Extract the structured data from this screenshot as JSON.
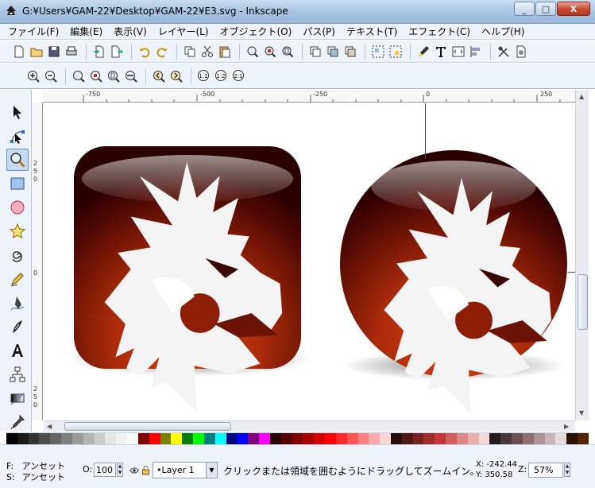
{
  "window": {
    "title": "G:¥Users¥GAM-22¥Desktop¥GAM-22¥E3.svg - Inkscape",
    "minimize": "_",
    "maximize": "□",
    "close": "X"
  },
  "menu": [
    "ファイル(F)",
    "編集(E)",
    "表示(V)",
    "レイヤー(L)",
    "オブジェクト(O)",
    "パス(P)",
    "テキスト(T)",
    "エフェクト(C)",
    "ヘルプ(H)"
  ],
  "ruler": {
    "h": [
      "-750",
      "-500",
      "-250",
      "0",
      "250"
    ],
    "v": [
      "2",
      "5",
      "0",
      "2",
      "5",
      "0",
      "0",
      "2",
      "5",
      "0"
    ]
  },
  "status": {
    "fill_label": "F:",
    "stroke_label": "S:",
    "fill_value": "アンセット",
    "stroke_value": "アンセット",
    "opacity_label": "O:",
    "opacity_value": "100",
    "layer": "•Layer 1",
    "message": "クリックまたは領域を囲むようにドラッグしてズームイン。",
    "x": "X: -242.44",
    "y": "Y: 350.58",
    "zoom_label": "Z:",
    "zoom_value": "57%"
  },
  "palette": [
    "#000000",
    "#1a1a1a",
    "#333333",
    "#4d4d4d",
    "#666666",
    "#808080",
    "#999999",
    "#b3b3b3",
    "#cccccc",
    "#e6e6e6",
    "#f2f2f2",
    "#ffffff",
    "#800000",
    "#ff0000",
    "#808000",
    "#ffff00",
    "#008000",
    "#00ff00",
    "#008080",
    "#00ffff",
    "#000080",
    "#0000ff",
    "#800080",
    "#ff00ff",
    "#2b0000",
    "#550000",
    "#800000",
    "#aa0000",
    "#d40000",
    "#ff0000",
    "#ff2a2a",
    "#ff5555",
    "#ff8080",
    "#ffaaaa",
    "#ffd5d5",
    "#280b0b",
    "#501616",
    "#782121",
    "#a02c2c",
    "#c83737",
    "#d35f5f",
    "#de8787",
    "#e9afaf",
    "#f4d7d7",
    "#241c1c",
    "#483737",
    "#6c5353",
    "#916f6f",
    "#ac9393",
    "#c8b7b7",
    "#e3dbdb",
    "#2b1100",
    "#552200"
  ],
  "colors": {
    "chrome": "#eef3fa",
    "icon_dark": "#2b0000",
    "icon_red": "#b32b0a",
    "icon_orange": "#d8420e"
  }
}
